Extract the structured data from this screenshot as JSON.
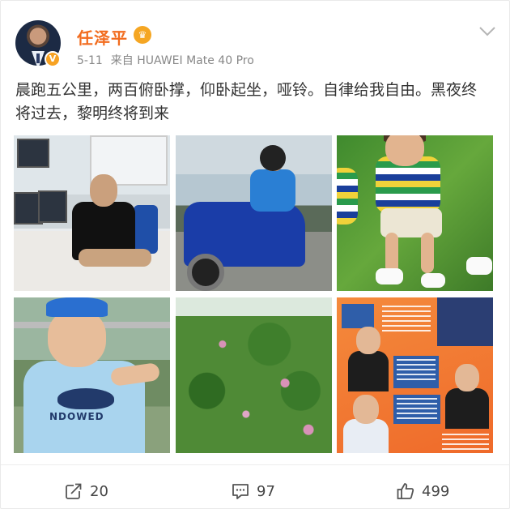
{
  "author": {
    "name": "任泽平",
    "verified_badge": "V",
    "name_color": "#f26c1e"
  },
  "meta": {
    "date": "5-11",
    "source_prefix": "来自",
    "device": "HUAWEI Mate 40 Pro"
  },
  "post": {
    "text": "晨跑五公里，两百俯卧撑，仰卧起坐，哑铃。自律给我自由。黑夜终将过去，黎明终将到来"
  },
  "photos": {
    "count": 6,
    "shirt_text": "NDOWED"
  },
  "actions": {
    "repost_count": "20",
    "comment_count": "97",
    "like_count": "499"
  },
  "icons": {
    "repost": "share-icon",
    "comment": "comment-icon",
    "like": "thumbs-up-icon",
    "menu": "chevron-down-icon",
    "member": "crown-icon"
  }
}
